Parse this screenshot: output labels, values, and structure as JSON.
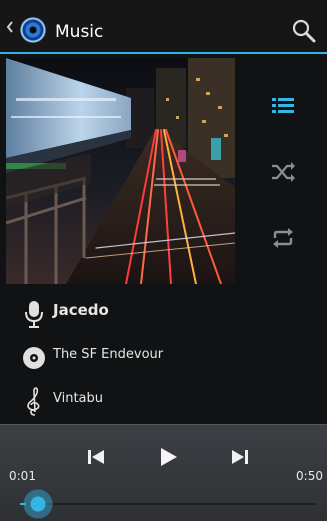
{
  "action_bar": {
    "title": "Music",
    "icons": [
      "up-caret-icon",
      "music-app-icon",
      "search-icon"
    ]
  },
  "album": {
    "icon": "album-art"
  },
  "side_controls": [
    {
      "name": "playlist",
      "icon": "queue-list-icon",
      "color": "#33b5e5"
    },
    {
      "name": "shuffle",
      "icon": "shuffle-icon",
      "color": "#8a8d91"
    },
    {
      "name": "repeat",
      "icon": "repeat-icon",
      "color": "#8a8d91"
    }
  ],
  "track_info": {
    "artist": "Jacedo",
    "album": "The SF Endevour",
    "composer": "Vintabu"
  },
  "player": {
    "elapsed": "0:01",
    "duration": "0:50",
    "progress": 0.02,
    "accent": "#33b5e5"
  }
}
